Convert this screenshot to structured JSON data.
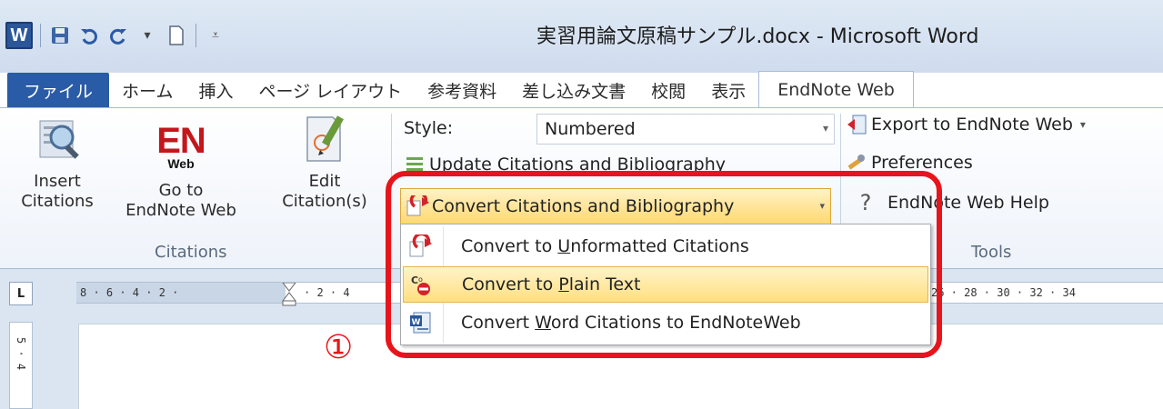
{
  "window": {
    "title": "実習用論文原稿サンプル.docx - Microsoft Word",
    "app_letter": "W"
  },
  "tabs": [
    {
      "label": "ファイル"
    },
    {
      "label": "ホーム"
    },
    {
      "label": "挿入"
    },
    {
      "label": "ページ レイアウト"
    },
    {
      "label": "参考資料"
    },
    {
      "label": "差し込み文書"
    },
    {
      "label": "校閲"
    },
    {
      "label": "表示"
    },
    {
      "label": "EndNote Web"
    }
  ],
  "citations_group": {
    "label": "Citations",
    "insert": {
      "line1": "Insert",
      "line2": "Citations"
    },
    "goto": {
      "logo": "EN",
      "logo_sub": "Web",
      "line1": "Go to",
      "line2": "EndNote Web"
    },
    "edit": {
      "line1": "Edit",
      "line2": "Citation(s)"
    }
  },
  "bibliography_group": {
    "style_label": "Style:",
    "style_value": "Numbered",
    "update_label": "Update Citations and Bibliography",
    "convert_label": "Convert Citations and Bibliography"
  },
  "tools_group": {
    "label": "Tools",
    "export_label": "Export to EndNote Web",
    "preferences_label": "Preferences",
    "help_label": "EndNote Web Help"
  },
  "menu": {
    "items": [
      {
        "pre": "Convert to ",
        "u": "U",
        "post": "nformatted Citations"
      },
      {
        "pre": "Convert to ",
        "u": "P",
        "post": "lain Text"
      },
      {
        "pre": "Convert ",
        "u": "W",
        "post": "ord Citations to EndNoteWeb"
      }
    ]
  },
  "ruler": {
    "corner": "L",
    "left_ticks": "8 · 6 · 4 · 2 ·",
    "right_ticks": "26 · 28 · 30 · 32 · 34",
    "right_start": "· 2 · 4",
    "vertical": "5 · 4"
  },
  "annotation": {
    "marker": "①"
  },
  "colors": {
    "accent": "#2a5ba6",
    "highlight": "#ffd971",
    "annotation": "#e8141b",
    "en_logo": "#c4161c"
  }
}
